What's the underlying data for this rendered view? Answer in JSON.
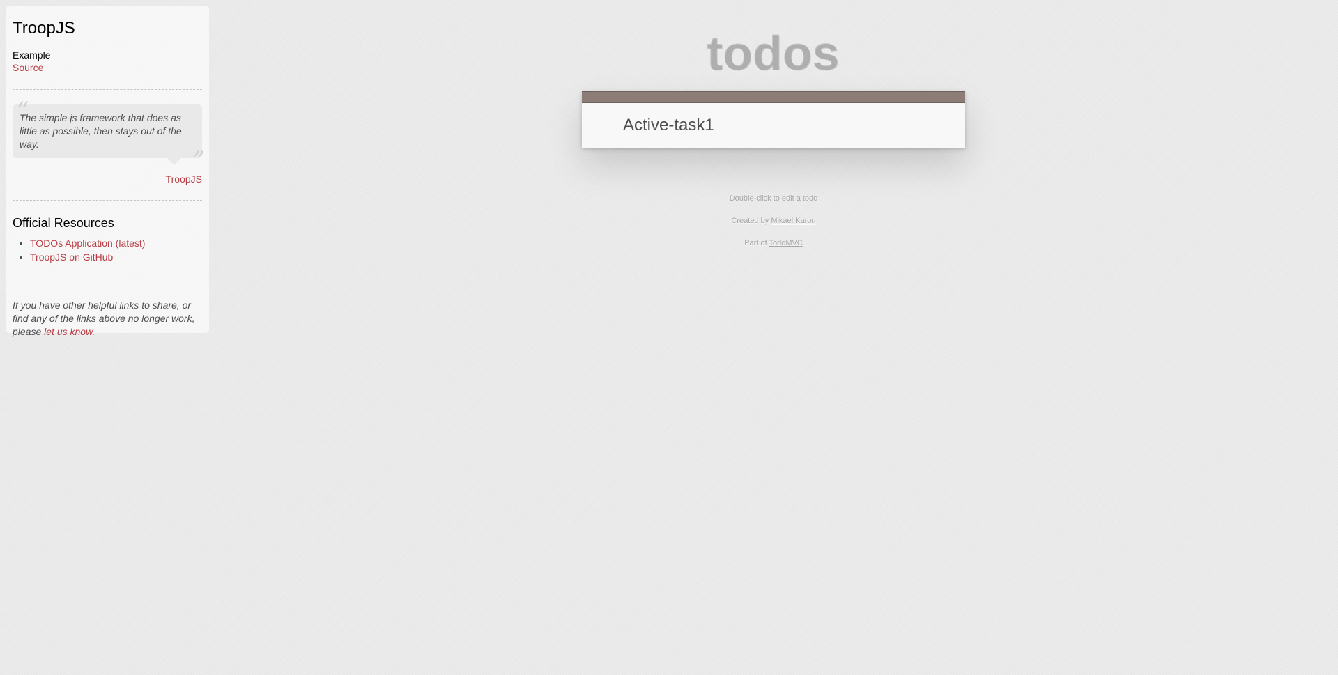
{
  "sidebar": {
    "title": "TroopJS",
    "example_label": "Example",
    "source_link": "Source",
    "quote": {
      "text": "The simple js framework that does as little as possible, then stays out of the way.",
      "author": "TroopJS"
    },
    "resources_heading": "Official Resources",
    "resources": [
      {
        "label": "TODOs Application (latest)"
      },
      {
        "label": "TroopJS on GitHub"
      }
    ],
    "footer_note_prefix": "If you have other helpful links to share, or find any of the links above no longer work, please ",
    "footer_note_link": "let us know",
    "footer_note_suffix": "."
  },
  "app": {
    "title": "todos",
    "new_todo_value": "Active-task1"
  },
  "info": {
    "hint": "Double-click to edit a todo",
    "created_prefix": "Created by ",
    "created_by": "Mikael Karon",
    "part_prefix": "Part of ",
    "part_of": "TodoMVC"
  },
  "colors": {
    "accent_link": "#b83f45",
    "header_bar": "#8d7d77",
    "background": "#eaeaea"
  }
}
